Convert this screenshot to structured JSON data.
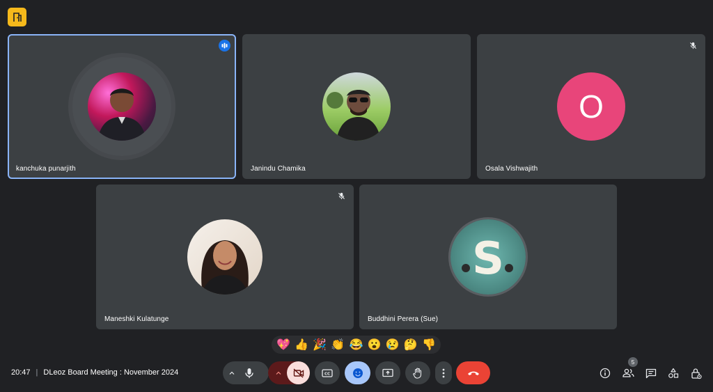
{
  "participants": [
    {
      "name": "kanchuka punarjith",
      "active": true
    },
    {
      "name": "Janindu Chamika"
    },
    {
      "name": "Osala Vishwajith",
      "initial": "O",
      "avatar_color": "#e8457a",
      "muted": true
    },
    {
      "name": "Maneshki Kulatunge",
      "muted": true
    },
    {
      "name": "Buddhini Perera (Sue)",
      "initial": "S"
    }
  ],
  "reactions": [
    "💖",
    "👍",
    "🎉",
    "👏",
    "😂",
    "😮",
    "😢",
    "🤔",
    "👎"
  ],
  "meeting": {
    "time": "20:47",
    "separator": "|",
    "title": "DLeoz Board Meeting : November 2024"
  },
  "people_count": "5",
  "colors": {
    "background": "#202124",
    "tile": "#3c4043",
    "active_border": "#8ab4f8",
    "end_call": "#ea4335",
    "camera_off": "#f9dedc",
    "emoji_active": "#a8c7fa",
    "logo": "#f6b91b"
  },
  "icons": {
    "mic": "mic-icon",
    "camera_off": "videocam-off-icon",
    "captions": "closed-captions-icon",
    "emoji": "emoji-icon",
    "present": "present-screen-icon",
    "raise_hand": "raise-hand-icon",
    "more": "more-vert-icon",
    "end_call": "call-end-icon",
    "info": "info-icon",
    "people": "people-icon",
    "chat": "chat-icon",
    "activities": "activities-icon",
    "host_controls": "host-controls-lock-icon"
  }
}
